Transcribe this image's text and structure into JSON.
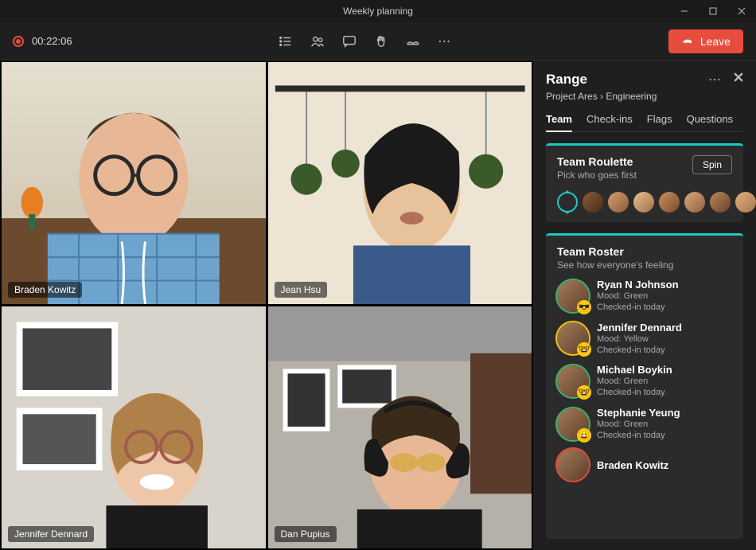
{
  "window": {
    "title": "Weekly planning"
  },
  "toolbar": {
    "timer": "00:22:06",
    "leave_label": "Leave"
  },
  "participants": [
    {
      "name": "Braden Kowitz"
    },
    {
      "name": "Jean Hsu"
    },
    {
      "name": "Jennifer Dennard"
    },
    {
      "name": "Dan Pupius"
    }
  ],
  "panel": {
    "title": "Range",
    "breadcrumb": "Project Ares › Engineering",
    "tabs": [
      {
        "label": "Team",
        "active": true
      },
      {
        "label": "Check-ins",
        "active": false
      },
      {
        "label": "Flags",
        "active": false
      },
      {
        "label": "Questions",
        "active": false
      }
    ],
    "roulette": {
      "title": "Team Roulette",
      "subtitle": "Pick who goes first",
      "button": "Spin",
      "avatar_count": 7
    },
    "roster": {
      "title": "Team Roster",
      "subtitle": "See how everyone's feeling",
      "items": [
        {
          "name": "Ryan N Johnson",
          "mood": "Mood: Green",
          "status": "Checked-in today",
          "ring": "green",
          "emoji": "😎"
        },
        {
          "name": "Jennifer Dennard",
          "mood": "Mood: Yellow",
          "status": "Checked-in today",
          "ring": "yellow",
          "emoji": "🤓"
        },
        {
          "name": "Michael Boykin",
          "mood": "Mood: Green",
          "status": "Checked-in today",
          "ring": "green",
          "emoji": "🤓"
        },
        {
          "name": "Stephanie Yeung",
          "mood": "Mood: Green",
          "status": "Checked-in today",
          "ring": "green",
          "emoji": "😀"
        },
        {
          "name": "Braden Kowitz",
          "mood": "",
          "status": "",
          "ring": "red",
          "emoji": ""
        }
      ]
    }
  }
}
